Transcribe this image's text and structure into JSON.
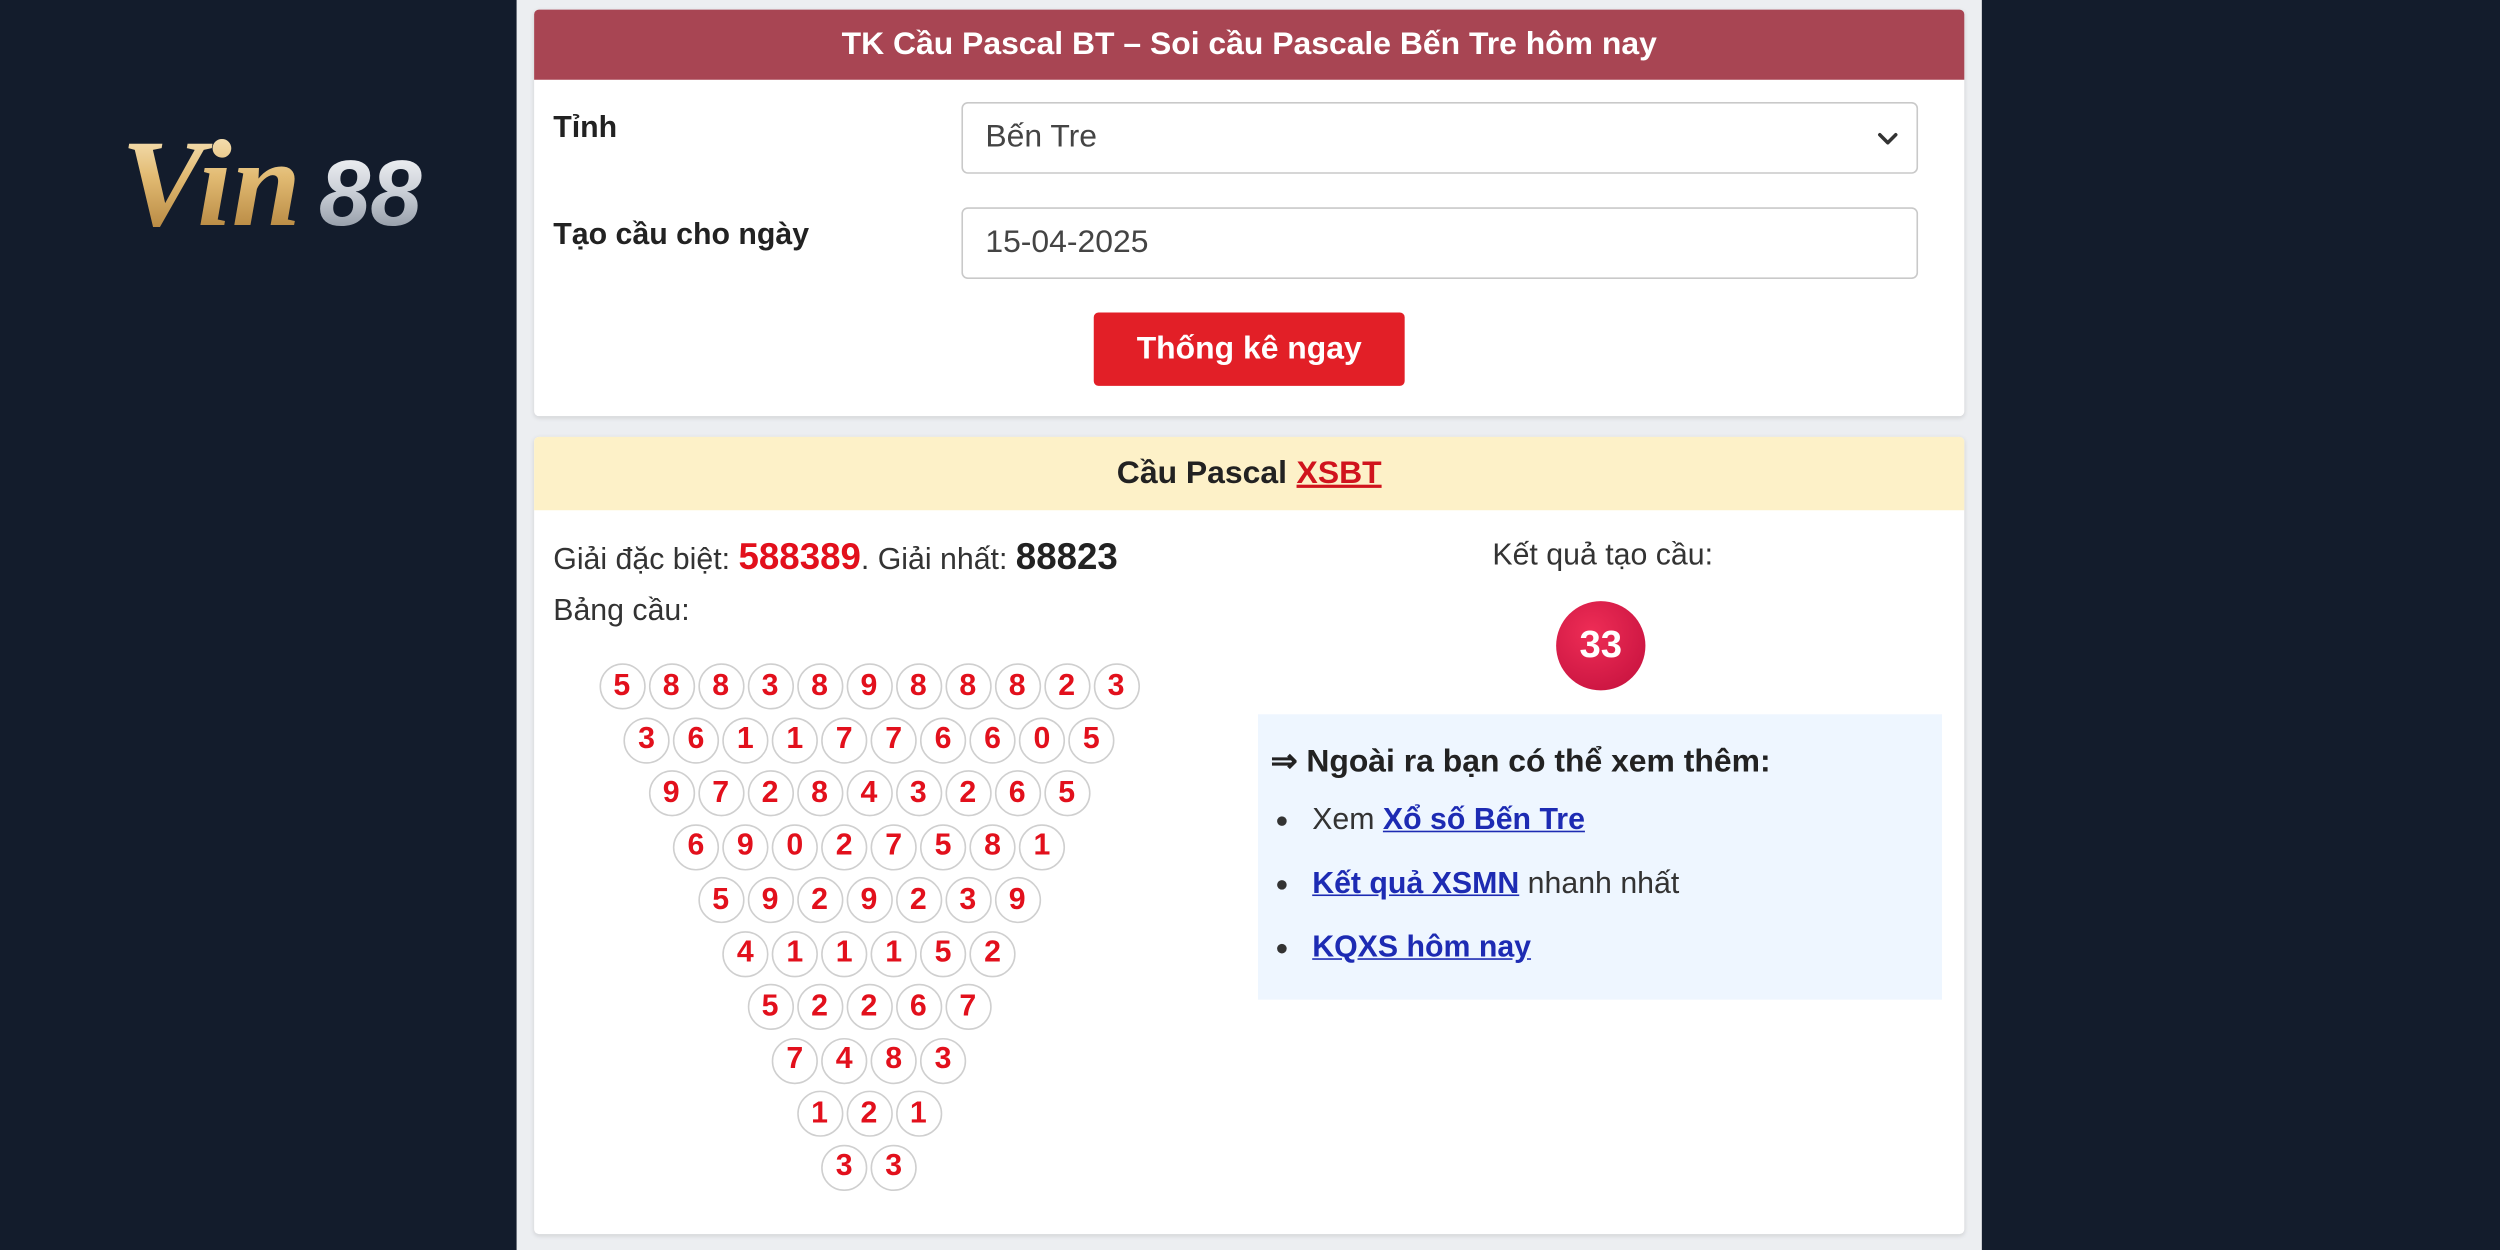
{
  "logo": {
    "text_left": "Vin",
    "text_right": "88"
  },
  "form": {
    "title": "TK Cầu Pascal BT – Soi cầu Pascale Bến Tre hôm nay",
    "province_label": "Tỉnh",
    "province_value": "Bến Tre",
    "date_label": "Tạo cầu cho ngày",
    "date_value": "15-04-2025",
    "submit_label": "Thống kê ngay"
  },
  "result": {
    "header_text": "Cầu Pascal",
    "header_link": "XSBT",
    "special_label": "Giải đặc biệt:",
    "special_value": "588389",
    "first_sep": ". Giải nhất:",
    "first_value": "88823",
    "table_label": "Bảng cầu:",
    "pascal_rows": [
      [
        "5",
        "8",
        "8",
        "3",
        "8",
        "9",
        "8",
        "8",
        "8",
        "2",
        "3"
      ],
      [
        "3",
        "6",
        "1",
        "1",
        "7",
        "7",
        "6",
        "6",
        "0",
        "5"
      ],
      [
        "9",
        "7",
        "2",
        "8",
        "4",
        "3",
        "2",
        "6",
        "5"
      ],
      [
        "6",
        "9",
        "0",
        "2",
        "7",
        "5",
        "8",
        "1"
      ],
      [
        "5",
        "9",
        "2",
        "9",
        "2",
        "3",
        "9"
      ],
      [
        "4",
        "1",
        "1",
        "1",
        "5",
        "2"
      ],
      [
        "5",
        "2",
        "2",
        "6",
        "7"
      ],
      [
        "7",
        "4",
        "8",
        "3"
      ],
      [
        "1",
        "2",
        "1"
      ],
      [
        "3",
        "3"
      ]
    ],
    "outcome_label": "Kết quả tạo cầu:",
    "outcome_value": "33"
  },
  "more": {
    "title": "⇒ Ngoài ra bạn có thể xem thêm:",
    "items": [
      {
        "prefix": "Xem",
        "link": "Xổ số Bến Tre",
        "suffix": ""
      },
      {
        "prefix": "",
        "link": "Kết quả XSMN",
        "suffix": "nhanh nhất"
      },
      {
        "prefix": "",
        "link": "KQXS hôm nay",
        "suffix": ""
      }
    ]
  },
  "colors": {
    "page_bg": "#131c2c",
    "form_header": "#a84553",
    "result_header": "#fdf1c8",
    "accent_red": "#e2101c",
    "link_blue": "#1d2bb3"
  }
}
